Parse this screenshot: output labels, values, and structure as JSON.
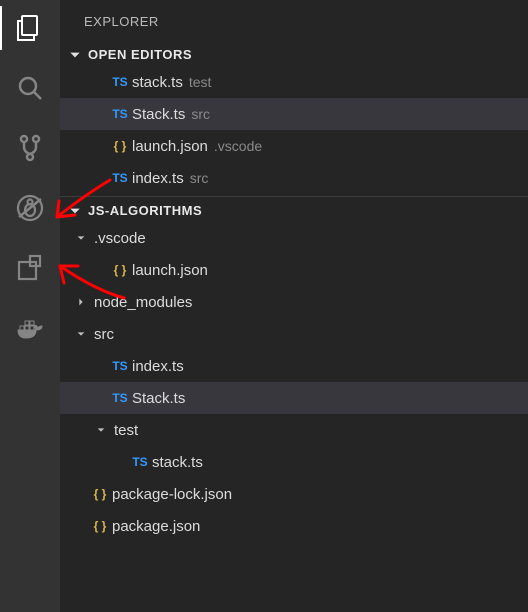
{
  "sidebar": {
    "title": "EXPLORER",
    "sections": {
      "openEditors": {
        "label": "OPEN EDITORS",
        "items": [
          {
            "icon": "ts",
            "iconText": "TS",
            "name": "stack.ts",
            "desc": "test",
            "selected": false
          },
          {
            "icon": "ts",
            "iconText": "TS",
            "name": "Stack.ts",
            "desc": "src",
            "selected": true
          },
          {
            "icon": "json",
            "iconText": "{ }",
            "name": "launch.json",
            "desc": ".vscode",
            "selected": false
          },
          {
            "icon": "ts",
            "iconText": "TS",
            "name": "index.ts",
            "desc": "src",
            "selected": false
          }
        ]
      },
      "workspace": {
        "label": "JS-ALGORITHMS",
        "tree": [
          {
            "kind": "folder",
            "name": ".vscode",
            "depth": 0,
            "state": "open"
          },
          {
            "kind": "file",
            "name": "launch.json",
            "depth": 1,
            "icon": "json",
            "iconText": "{ }"
          },
          {
            "kind": "folder",
            "name": "node_modules",
            "depth": 0,
            "state": "closed"
          },
          {
            "kind": "folder",
            "name": "src",
            "depth": 0,
            "state": "open"
          },
          {
            "kind": "file",
            "name": "index.ts",
            "depth": 1,
            "icon": "ts",
            "iconText": "TS"
          },
          {
            "kind": "file",
            "name": "Stack.ts",
            "depth": 1,
            "icon": "ts",
            "iconText": "TS",
            "selected": true
          },
          {
            "kind": "folder",
            "name": "test",
            "depth": 1,
            "state": "open"
          },
          {
            "kind": "file",
            "name": "stack.ts",
            "depth": 2,
            "icon": "ts",
            "iconText": "TS"
          },
          {
            "kind": "file",
            "name": "package-lock.json",
            "depth": 0,
            "icon": "json",
            "iconText": "{ }"
          },
          {
            "kind": "file",
            "name": "package.json",
            "depth": 0,
            "icon": "json",
            "iconText": "{ }"
          }
        ]
      }
    }
  },
  "activity": {
    "items": [
      {
        "id": "explorer",
        "icon": "files",
        "active": true
      },
      {
        "id": "search",
        "icon": "search",
        "active": false
      },
      {
        "id": "scm",
        "icon": "branch",
        "active": false
      },
      {
        "id": "debug",
        "icon": "debug",
        "active": false
      },
      {
        "id": "extensions",
        "icon": "extensions",
        "active": false
      },
      {
        "id": "docker",
        "icon": "docker",
        "active": false
      }
    ]
  },
  "colors": {
    "tsBlue": "#3399ff",
    "jsonGold": "#d9b74a",
    "arrowRed": "#ff0000"
  }
}
